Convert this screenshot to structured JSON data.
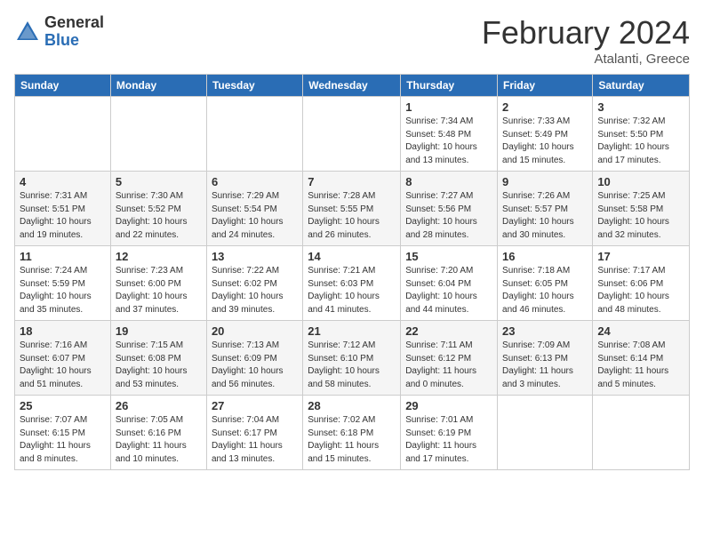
{
  "header": {
    "logo_general": "General",
    "logo_blue": "Blue",
    "month_title": "February 2024",
    "location": "Atalanti, Greece"
  },
  "weekdays": [
    "Sunday",
    "Monday",
    "Tuesday",
    "Wednesday",
    "Thursday",
    "Friday",
    "Saturday"
  ],
  "weeks": [
    [
      {
        "day": "",
        "info": ""
      },
      {
        "day": "",
        "info": ""
      },
      {
        "day": "",
        "info": ""
      },
      {
        "day": "",
        "info": ""
      },
      {
        "day": "1",
        "info": "Sunrise: 7:34 AM\nSunset: 5:48 PM\nDaylight: 10 hours\nand 13 minutes."
      },
      {
        "day": "2",
        "info": "Sunrise: 7:33 AM\nSunset: 5:49 PM\nDaylight: 10 hours\nand 15 minutes."
      },
      {
        "day": "3",
        "info": "Sunrise: 7:32 AM\nSunset: 5:50 PM\nDaylight: 10 hours\nand 17 minutes."
      }
    ],
    [
      {
        "day": "4",
        "info": "Sunrise: 7:31 AM\nSunset: 5:51 PM\nDaylight: 10 hours\nand 19 minutes."
      },
      {
        "day": "5",
        "info": "Sunrise: 7:30 AM\nSunset: 5:52 PM\nDaylight: 10 hours\nand 22 minutes."
      },
      {
        "day": "6",
        "info": "Sunrise: 7:29 AM\nSunset: 5:54 PM\nDaylight: 10 hours\nand 24 minutes."
      },
      {
        "day": "7",
        "info": "Sunrise: 7:28 AM\nSunset: 5:55 PM\nDaylight: 10 hours\nand 26 minutes."
      },
      {
        "day": "8",
        "info": "Sunrise: 7:27 AM\nSunset: 5:56 PM\nDaylight: 10 hours\nand 28 minutes."
      },
      {
        "day": "9",
        "info": "Sunrise: 7:26 AM\nSunset: 5:57 PM\nDaylight: 10 hours\nand 30 minutes."
      },
      {
        "day": "10",
        "info": "Sunrise: 7:25 AM\nSunset: 5:58 PM\nDaylight: 10 hours\nand 32 minutes."
      }
    ],
    [
      {
        "day": "11",
        "info": "Sunrise: 7:24 AM\nSunset: 5:59 PM\nDaylight: 10 hours\nand 35 minutes."
      },
      {
        "day": "12",
        "info": "Sunrise: 7:23 AM\nSunset: 6:00 PM\nDaylight: 10 hours\nand 37 minutes."
      },
      {
        "day": "13",
        "info": "Sunrise: 7:22 AM\nSunset: 6:02 PM\nDaylight: 10 hours\nand 39 minutes."
      },
      {
        "day": "14",
        "info": "Sunrise: 7:21 AM\nSunset: 6:03 PM\nDaylight: 10 hours\nand 41 minutes."
      },
      {
        "day": "15",
        "info": "Sunrise: 7:20 AM\nSunset: 6:04 PM\nDaylight: 10 hours\nand 44 minutes."
      },
      {
        "day": "16",
        "info": "Sunrise: 7:18 AM\nSunset: 6:05 PM\nDaylight: 10 hours\nand 46 minutes."
      },
      {
        "day": "17",
        "info": "Sunrise: 7:17 AM\nSunset: 6:06 PM\nDaylight: 10 hours\nand 48 minutes."
      }
    ],
    [
      {
        "day": "18",
        "info": "Sunrise: 7:16 AM\nSunset: 6:07 PM\nDaylight: 10 hours\nand 51 minutes."
      },
      {
        "day": "19",
        "info": "Sunrise: 7:15 AM\nSunset: 6:08 PM\nDaylight: 10 hours\nand 53 minutes."
      },
      {
        "day": "20",
        "info": "Sunrise: 7:13 AM\nSunset: 6:09 PM\nDaylight: 10 hours\nand 56 minutes."
      },
      {
        "day": "21",
        "info": "Sunrise: 7:12 AM\nSunset: 6:10 PM\nDaylight: 10 hours\nand 58 minutes."
      },
      {
        "day": "22",
        "info": "Sunrise: 7:11 AM\nSunset: 6:12 PM\nDaylight: 11 hours\nand 0 minutes."
      },
      {
        "day": "23",
        "info": "Sunrise: 7:09 AM\nSunset: 6:13 PM\nDaylight: 11 hours\nand 3 minutes."
      },
      {
        "day": "24",
        "info": "Sunrise: 7:08 AM\nSunset: 6:14 PM\nDaylight: 11 hours\nand 5 minutes."
      }
    ],
    [
      {
        "day": "25",
        "info": "Sunrise: 7:07 AM\nSunset: 6:15 PM\nDaylight: 11 hours\nand 8 minutes."
      },
      {
        "day": "26",
        "info": "Sunrise: 7:05 AM\nSunset: 6:16 PM\nDaylight: 11 hours\nand 10 minutes."
      },
      {
        "day": "27",
        "info": "Sunrise: 7:04 AM\nSunset: 6:17 PM\nDaylight: 11 hours\nand 13 minutes."
      },
      {
        "day": "28",
        "info": "Sunrise: 7:02 AM\nSunset: 6:18 PM\nDaylight: 11 hours\nand 15 minutes."
      },
      {
        "day": "29",
        "info": "Sunrise: 7:01 AM\nSunset: 6:19 PM\nDaylight: 11 hours\nand 17 minutes."
      },
      {
        "day": "",
        "info": ""
      },
      {
        "day": "",
        "info": ""
      }
    ]
  ]
}
